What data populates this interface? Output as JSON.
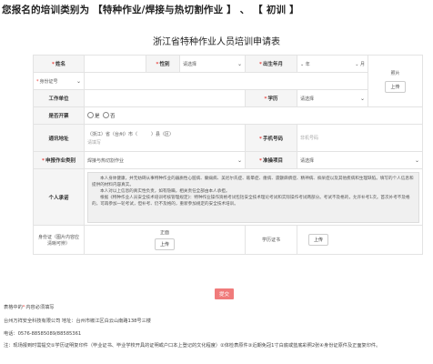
{
  "header": {
    "prefix": "您报名的培训类别为",
    "category": "【特种作业/焊接与热切割作业 】",
    "sep": "、",
    "level": "【 初训 】"
  },
  "form": {
    "title": "浙江省特种作业人员培训申请表",
    "name_label": "姓名",
    "gender_label": "性别",
    "gender_value": "请选择",
    "birth_label": "出生年月",
    "year_label": "年",
    "month_label": "月",
    "photo_label": "照片",
    "photo_upload": "上传",
    "idtype_value": "身份证号",
    "work_unit_label": "工作单位",
    "education_label": "学历",
    "education_value": "请选择",
    "ticket_label": "是否开票",
    "yes": "是",
    "no": "否",
    "address_label": "通讯地址",
    "address_text": "（浙江）省（台州）市（　　　）县（区）",
    "address_placeholder": "请填写",
    "mobile_label": "手机号码",
    "mobile_placeholder": "非机号码",
    "category_label": "申报作业类别",
    "category_value": "焊接与热切割作业",
    "project_label": "准操项目",
    "project_value": "请选择",
    "promise_label": "个人承诺",
    "promise_p1": "本人身体健康，并无妨碍从事特种作业的器质性心脏病、癫痫病、美尼尔氏症、眩晕症、癔病、震颤麻痹症、精神病、痴呆症以及其他疾病和生理缺陷。填写的个人信息和提供的材料内容真实。",
    "promise_p2": "本人对以上信息的真实性负责，如有隐瞒，相关责任全部由本人承担。",
    "promise_p3": "根据《特种作业人员安全技术培训考核管理规定》：特种作业操作资格考试包括安全技术理论考试和实际操作考试两部分。考试不及格的，允许补考1次。首次补考不及格的，可再参加一轮考试，但补考、仍不及格的，重新参加规定的安全技术培训。",
    "id_photo_label": "身份证（图片内容应清晰可辨）",
    "front_label": "正面",
    "upload": "上传",
    "edu_cert_label": "学历证书",
    "edu_upload": "上传"
  },
  "submit_label": "提交",
  "footer": {
    "required_note_prefix": "表格中的",
    "required_note_suffix": "内容必须填写",
    "company": "台州万祥安全科技有限公司 地址：台州市椒江区白云山南路138号三楼",
    "phone": "电话：0576-88585089/88585361",
    "note": "注：现场报到时需提交①学历证明复印件（毕业证书、毕业学校开具的证明或户口本上登记的文化程度）②体检表原件③近期免冠1寸白底或蓝底彩照2张④身份证原件及正面复印件。"
  }
}
